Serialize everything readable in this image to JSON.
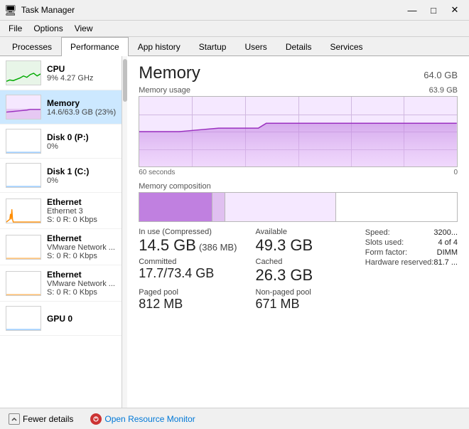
{
  "titleBar": {
    "icon": "⊞",
    "title": "Task Manager",
    "minimize": "—",
    "maximize": "□",
    "close": "✕"
  },
  "menuBar": {
    "items": [
      "File",
      "Options",
      "View"
    ]
  },
  "tabs": [
    {
      "label": "Processes",
      "active": false
    },
    {
      "label": "Performance",
      "active": true
    },
    {
      "label": "App history",
      "active": false
    },
    {
      "label": "Startup",
      "active": false
    },
    {
      "label": "Users",
      "active": false
    },
    {
      "label": "Details",
      "active": false
    },
    {
      "label": "Services",
      "active": false
    }
  ],
  "sidebar": {
    "items": [
      {
        "id": "cpu",
        "title": "CPU",
        "sub": "9%  4.27 GHz",
        "active": false,
        "graphType": "cpu"
      },
      {
        "id": "memory",
        "title": "Memory",
        "sub": "14.6/63.9 GB (23%)",
        "active": true,
        "graphType": "memory"
      },
      {
        "id": "disk0",
        "title": "Disk 0 (P:)",
        "sub": "0%",
        "active": false,
        "graphType": "disk"
      },
      {
        "id": "disk1",
        "title": "Disk 1 (C:)",
        "sub": "0%",
        "active": false,
        "graphType": "disk"
      },
      {
        "id": "eth0",
        "title": "Ethernet",
        "sub": "Ethernet 3",
        "sub2": "S: 0 R: 0 Kbps",
        "active": false,
        "graphType": "eth"
      },
      {
        "id": "eth1",
        "title": "Ethernet",
        "sub": "VMware Network ...",
        "sub2": "S: 0 R: 0 Kbps",
        "active": false,
        "graphType": "eth"
      },
      {
        "id": "eth2",
        "title": "Ethernet",
        "sub": "VMware Network ...",
        "sub2": "S: 0 R: 0 Kbps",
        "active": false,
        "graphType": "eth"
      },
      {
        "id": "gpu0",
        "title": "GPU 0",
        "sub": "",
        "active": false,
        "graphType": "disk"
      }
    ]
  },
  "content": {
    "title": "Memory",
    "capacity": "64.0 GB",
    "chartLabel": "Memory usage",
    "chartMax": "63.9 GB",
    "timeStart": "60 seconds",
    "timeEnd": "0",
    "compositionLabel": "Memory composition",
    "stats": {
      "inUse": {
        "label": "In use (Compressed)",
        "value": "14.5 GB",
        "sub": "(386 MB)"
      },
      "available": {
        "label": "Available",
        "value": "49.3 GB"
      },
      "committed": {
        "label": "Committed",
        "value": "17.7/73.4 GB"
      },
      "cached": {
        "label": "Cached",
        "value": "26.3 GB"
      },
      "pagedPool": {
        "label": "Paged pool",
        "value": "812 MB"
      },
      "nonPagedPool": {
        "label": "Non-paged pool",
        "value": "671 MB"
      },
      "speed": {
        "label": "Speed:",
        "value": "3200..."
      },
      "slotsUsed": {
        "label": "Slots used:",
        "value": "4 of 4"
      },
      "formFactor": {
        "label": "Form factor:",
        "value": "DIMM"
      },
      "hardwareReserved": {
        "label": "Hardware reserved:",
        "value": "81.7 ..."
      }
    }
  },
  "bottomBar": {
    "fewerDetails": "Fewer details",
    "openMonitor": "Open Resource Monitor"
  }
}
